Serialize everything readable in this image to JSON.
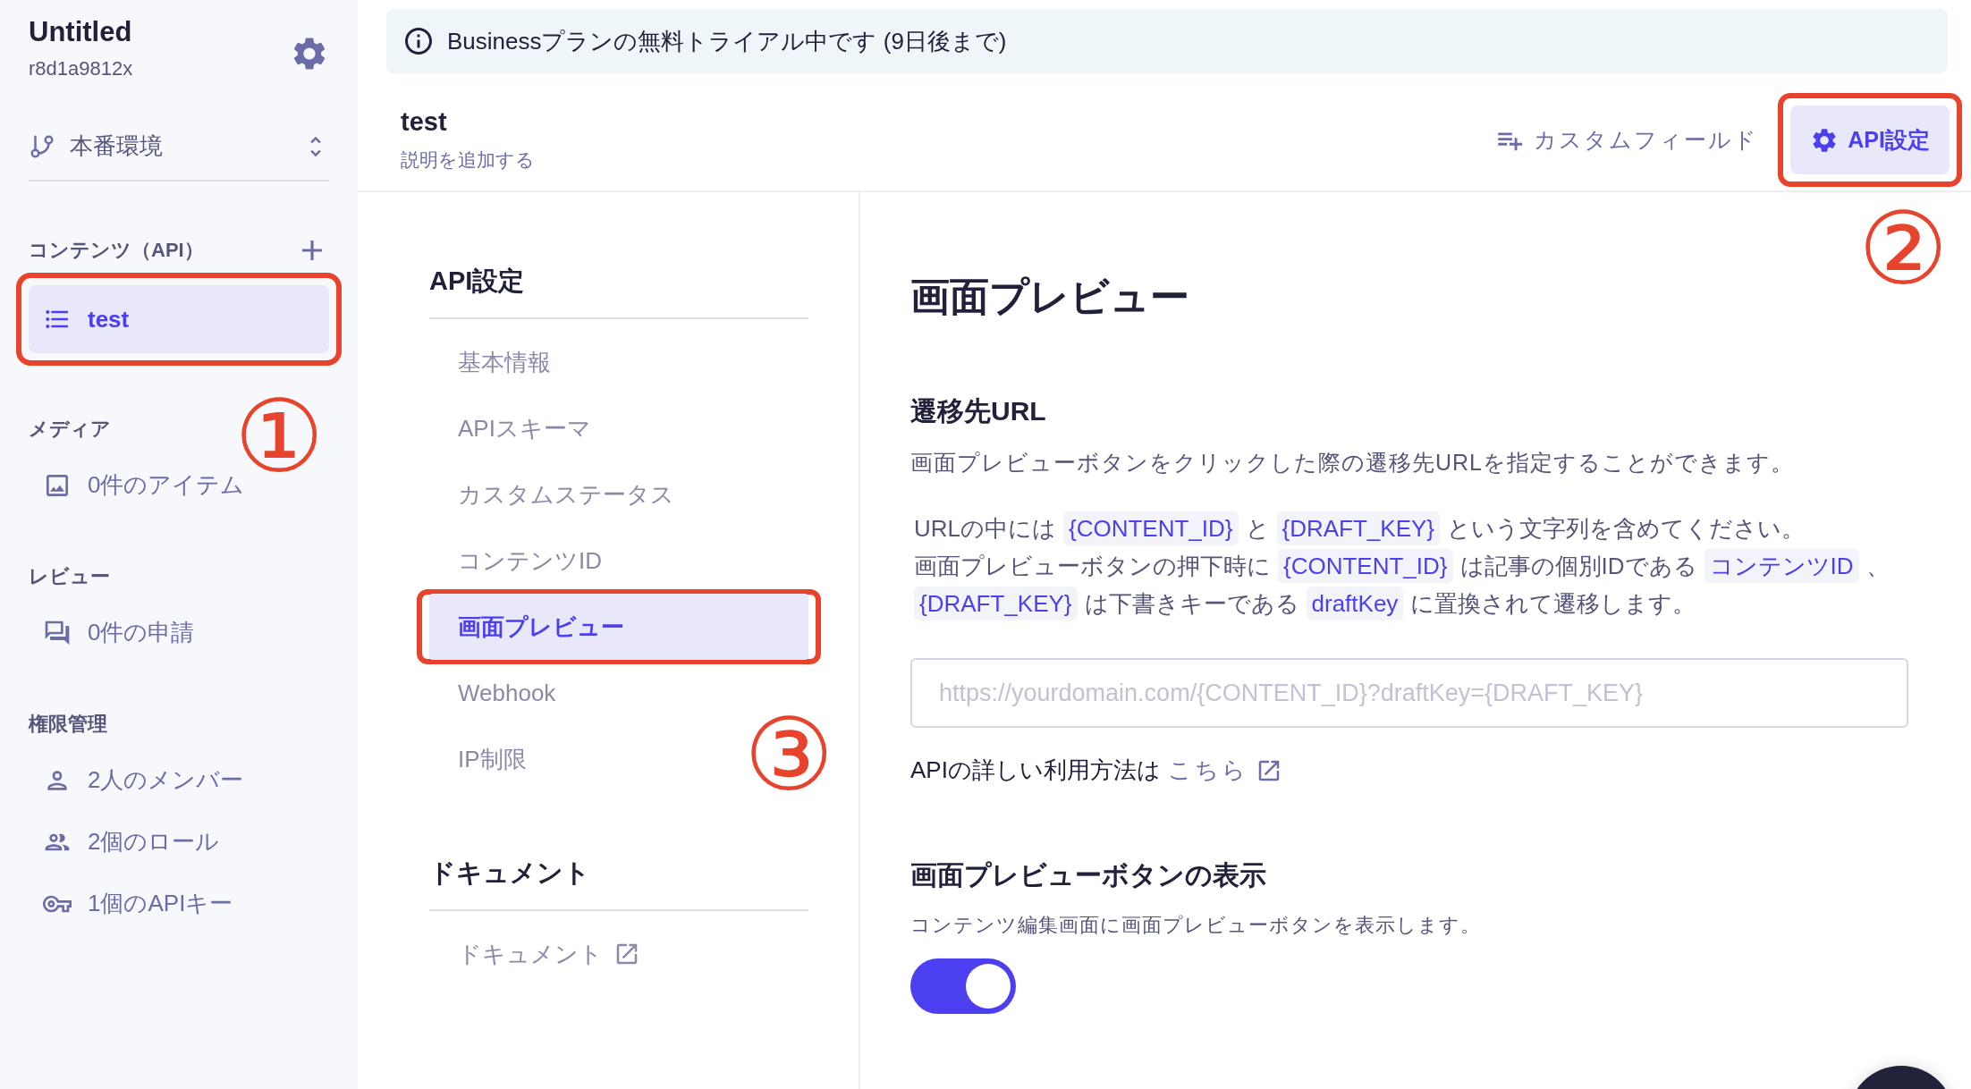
{
  "sidebar": {
    "project_name": "Untitled",
    "project_id": "r8d1a9812x",
    "environment": "本番環境",
    "sections": [
      {
        "title": "コンテンツ（API）",
        "addable": true,
        "items": [
          {
            "label": "test",
            "selected": true,
            "highlighted": true
          }
        ]
      },
      {
        "title": "メディア",
        "addable": false,
        "items": [
          {
            "label": "0件のアイテム",
            "selected": false,
            "highlighted": false
          }
        ]
      },
      {
        "title": "レビュー",
        "addable": false,
        "items": [
          {
            "label": "0件の申請",
            "selected": false,
            "highlighted": false
          }
        ]
      },
      {
        "title": "権限管理",
        "addable": false,
        "items": [
          {
            "label": "2人のメンバー",
            "selected": false,
            "highlighted": false
          },
          {
            "label": "2個のロール",
            "selected": false,
            "highlighted": false
          },
          {
            "label": "1個のAPIキー",
            "selected": false,
            "highlighted": false
          }
        ]
      }
    ]
  },
  "banner": {
    "text": "Businessプランの無料トライアル中です (9日後まで)"
  },
  "header": {
    "title": "test",
    "subtitle": "説明を追加する",
    "custom_field_button": "カスタムフィールド",
    "api_settings_button": {
      "label": "API設定",
      "highlighted": true
    }
  },
  "settings_nav": [
    {
      "title": "API設定",
      "items": [
        {
          "label": "基本情報",
          "selected": false,
          "highlighted": false,
          "external": false
        },
        {
          "label": "APIスキーマ",
          "selected": false,
          "highlighted": false,
          "external": false
        },
        {
          "label": "カスタムステータス",
          "selected": false,
          "highlighted": false,
          "external": false
        },
        {
          "label": "コンテンツID",
          "selected": false,
          "highlighted": false,
          "external": false
        },
        {
          "label": "画面プレビュー",
          "selected": true,
          "highlighted": true,
          "external": false
        },
        {
          "label": "Webhook",
          "selected": false,
          "highlighted": false,
          "external": false
        },
        {
          "label": "IP制限",
          "selected": false,
          "highlighted": false,
          "external": false
        }
      ]
    },
    {
      "title": "ドキュメント",
      "items": [
        {
          "label": "ドキュメント",
          "selected": false,
          "highlighted": false,
          "external": true
        }
      ]
    }
  ],
  "content": {
    "title": "画面プレビュー",
    "url_section": {
      "title": "遷移先URL",
      "description": "画面プレビューボタンをクリックした際の遷移先URLを指定することができます。",
      "paragraph_lines": [
        [
          {
            "kind": "text",
            "text": "URLの中には"
          },
          {
            "kind": "code",
            "text": "{CONTENT_ID}"
          },
          {
            "kind": "text",
            "text": "と"
          },
          {
            "kind": "code",
            "text": "{DRAFT_KEY}"
          },
          {
            "kind": "text",
            "text": "という文字列を含めてください。"
          }
        ],
        [
          {
            "kind": "text",
            "text": "画面プレビューボタンの押下時に"
          },
          {
            "kind": "code",
            "text": "{CONTENT_ID}"
          },
          {
            "kind": "text",
            "text": "は記事の個別IDである"
          },
          {
            "kind": "code",
            "text": "コンテンツID"
          },
          {
            "kind": "text",
            "text": "、"
          },
          {
            "kind": "code",
            "text": "{DRAFT_KEY}"
          },
          {
            "kind": "text",
            "text": "は下書きキーである"
          },
          {
            "kind": "code",
            "text": "draftKey"
          },
          {
            "kind": "text",
            "text": "に置換されて遷移します。"
          }
        ]
      ],
      "url_field": {
        "placeholder": "https://yourdomain.com/{CONTENT_ID}?draftKey={DRAFT_KEY}"
      },
      "help_text": "APIの詳しい利用方法は",
      "help_link": "こちら"
    },
    "toggle_section": {
      "title": "画面プレビューボタンの表示",
      "description": "コンテンツ編集画面に画面プレビューボタンを表示します。",
      "toggle": {
        "on": true
      }
    }
  },
  "annotations": [
    {
      "label": "①"
    },
    {
      "label": "②"
    },
    {
      "label": "③"
    }
  ]
}
